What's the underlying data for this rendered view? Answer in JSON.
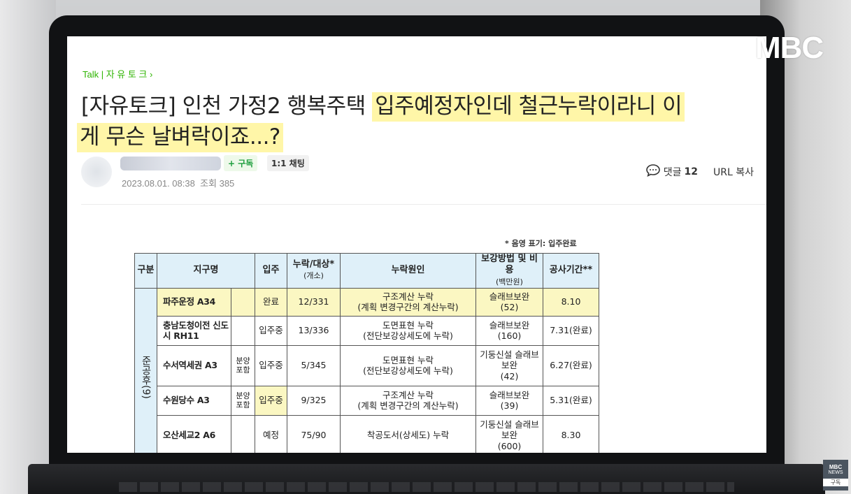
{
  "board": {
    "label": "Talk | 자 유 토 크"
  },
  "post": {
    "title_line1_plain": "[자유토크] 인천 가정2 행복주택 ",
    "title_line1_highlight": "입주예정자인데 철근누락이라니 이",
    "title_line2_highlight": "게 무슨 날벼락이죠...?",
    "date": "2023.08.01. 08:38",
    "views_label": "조회 385"
  },
  "author": {
    "subscribe_label": "+ 구독",
    "chat_label": "1:1 채팅"
  },
  "actions": {
    "comments_label": "댓글",
    "comments_count": "12",
    "url_copy_label": "URL 복사"
  },
  "table": {
    "note": "* 음영 표기: 입주완료",
    "headers": {
      "group": "구분",
      "district": "지구명",
      "status": "입주",
      "ratio": "누락/대상*",
      "ratio_unit": "(개소)",
      "cause": "누락원인",
      "method": "보강방법 및 비용",
      "method_unit": "(백만원)",
      "period": "공사기간**"
    },
    "group_label": "준공후(9)",
    "rows": [
      {
        "name": "파주운정 A34",
        "note": "",
        "status": "완료",
        "ratio": "12/331",
        "cause": "구조계산 누락",
        "cause_detail": "(계획 변경구간의 계산누락)",
        "method": "슬래브보완",
        "cost": "(52)",
        "period": "8.10"
      },
      {
        "name": "충남도청이전 신도시 RH11",
        "note": "",
        "status": "입주중",
        "ratio": "13/336",
        "cause": "도면표현 누락",
        "cause_detail": "(전단보강상세도에 누락)",
        "method": "슬래브보완",
        "cost": "(160)",
        "period": "7.31(완료)"
      },
      {
        "name": "수서역세권 A3",
        "note": "분양 포함",
        "status": "입주중",
        "ratio": "5/345",
        "cause": "도면표현 누락",
        "cause_detail": "(전단보강상세도에 누락)",
        "method": "기둥신설 슬래브보완",
        "cost": "(42)",
        "period": "6.27(완료)"
      },
      {
        "name": "수원당수 A3",
        "note": "분양 포함",
        "status": "입주중",
        "ratio": "9/325",
        "cause": "구조계산 누락",
        "cause_detail": "(계획 변경구간의 계산누락)",
        "method": "슬래브보완",
        "cost": "(39)",
        "period": "5.31(완료)"
      },
      {
        "name": "오산세교2 A6",
        "note": "",
        "status": "예정",
        "ratio": "75/90",
        "cause": "착공도서(상세도) 누락",
        "cause_detail": "",
        "method": "기둥신설 슬래브보완",
        "cost": "(600)",
        "period": "8.30"
      }
    ]
  },
  "broadcaster": {
    "logo": "MBC",
    "badge_top": "MBC",
    "badge_mid": "NEWS",
    "badge_sub": "구독"
  },
  "colors": {
    "highlight": "#fff6a8",
    "talk_green": "#2db400",
    "table_header": "#dff0f9",
    "table_done_row": "#fbf7c2"
  }
}
